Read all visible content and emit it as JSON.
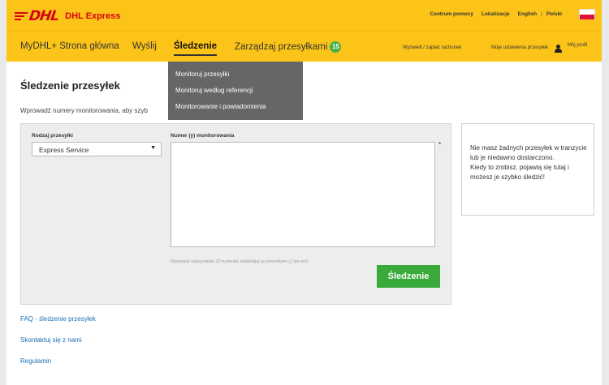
{
  "header": {
    "logo_text": "DHL",
    "brand_label": "DHL Express",
    "links": [
      "Centrum pomocy",
      "Lokalizacje",
      "English",
      "Polski"
    ],
    "separator": "|"
  },
  "nav": {
    "home": "MyDHL+ Strona główna",
    "send": "Wyślij",
    "track": "Śledzenie",
    "manage": "Zarządzaj przesyłkami",
    "manage_badge": "15",
    "bill": "Wyświetl / zapłać rachunek",
    "settings": "Moje ustawienia przesyłek",
    "profile": "Mój profil"
  },
  "dropdown": {
    "items": [
      "Monitoruj przesyłki",
      "Monitoruj według referencji",
      "Monitorowanie i powiadomienia"
    ]
  },
  "main": {
    "title": "Śledzenie przesyłek",
    "subtitle": "Wprowadź numery monitorowania, aby szyb"
  },
  "form": {
    "shipment_type_label": "Rodzaj przesyłki",
    "shipment_type_value": "Express Service",
    "tracking_label": "Numer (y) monitorowania",
    "required_mark": "*",
    "hint": "Wprowadź maksymalnie 10 numerów, oddzielając je przecinkiem (,) lub wróć",
    "submit": "Śledzenie"
  },
  "side_note": {
    "line1": "Nie masz żadnych przesyłek w tranzycie lub je niedawno dostarczono.",
    "line2": "Kiedy to zrobisz, pojawią się tutaj i możesz je szybko śledzić!"
  },
  "footer_links": [
    "FAQ - śledzenie przesyłek",
    "Skontaktuj się z nami",
    "Regulamin"
  ],
  "colors": {
    "brand_yellow": "#fcc419",
    "brand_red": "#d40511",
    "action_green": "#3aaa3a"
  }
}
